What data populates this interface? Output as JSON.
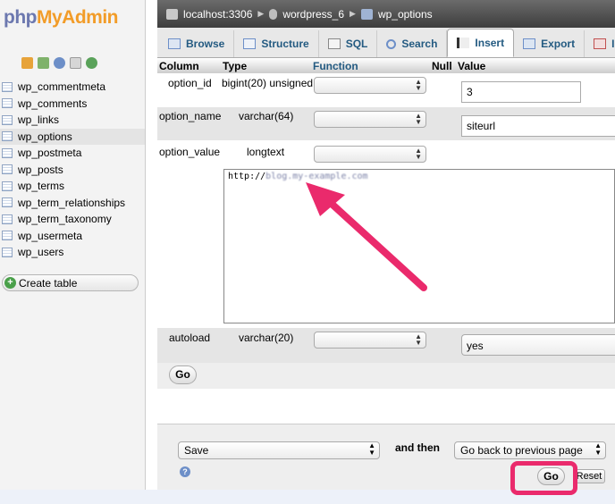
{
  "app": {
    "logo": {
      "php": "php",
      "my": "My",
      "admin": "Admin"
    }
  },
  "sidebar": {
    "tables": [
      {
        "label": "wp_commentmeta"
      },
      {
        "label": "wp_comments"
      },
      {
        "label": "wp_links"
      },
      {
        "label": "wp_options",
        "active": true
      },
      {
        "label": "wp_postmeta"
      },
      {
        "label": "wp_posts"
      },
      {
        "label": "wp_terms"
      },
      {
        "label": "wp_term_relationships"
      },
      {
        "label": "wp_term_taxonomy"
      },
      {
        "label": "wp_usermeta"
      },
      {
        "label": "wp_users"
      }
    ],
    "create_table": "Create table",
    "quick_icons": [
      "home-icon",
      "exit-icon",
      "help-icon",
      "docs-icon",
      "reload-icon"
    ]
  },
  "breadcrumb": {
    "server": "localhost:3306",
    "database": "wordpress_6",
    "table": "wp_options"
  },
  "tabs": [
    {
      "label": "Browse",
      "icon": "browse-icon"
    },
    {
      "label": "Structure",
      "icon": "structure-icon"
    },
    {
      "label": "SQL",
      "icon": "sql-icon"
    },
    {
      "label": "Search",
      "icon": "search-icon"
    },
    {
      "label": "Insert",
      "icon": "insert-icon",
      "active": true
    },
    {
      "label": "Export",
      "icon": "export-icon"
    },
    {
      "label": "Im",
      "icon": "import-icon"
    }
  ],
  "form": {
    "headers": {
      "column": "Column",
      "type": "Type",
      "function": "Function",
      "null": "Null",
      "value": "Value"
    },
    "rows": {
      "option_id": {
        "column": "option_id",
        "type": "bigint(20) unsigned",
        "value": "3"
      },
      "option_name": {
        "column": "option_name",
        "type": "varchar(64)",
        "value": "siteurl"
      },
      "option_value": {
        "column": "option_value",
        "type": "longtext",
        "value_prefix": "http://",
        "value_blurred": "blog.my-example.com"
      },
      "autoload": {
        "column": "autoload",
        "type": "varchar(20)",
        "value": "yes"
      }
    },
    "go_label": "Go"
  },
  "bottom": {
    "action_select": "Save",
    "and_then": "and then",
    "after_select": "Go back to previous page",
    "go_label": "Go",
    "reset_label": "Reset"
  },
  "colors": {
    "annotation": "#ea2a6c",
    "link": "#235a81"
  }
}
